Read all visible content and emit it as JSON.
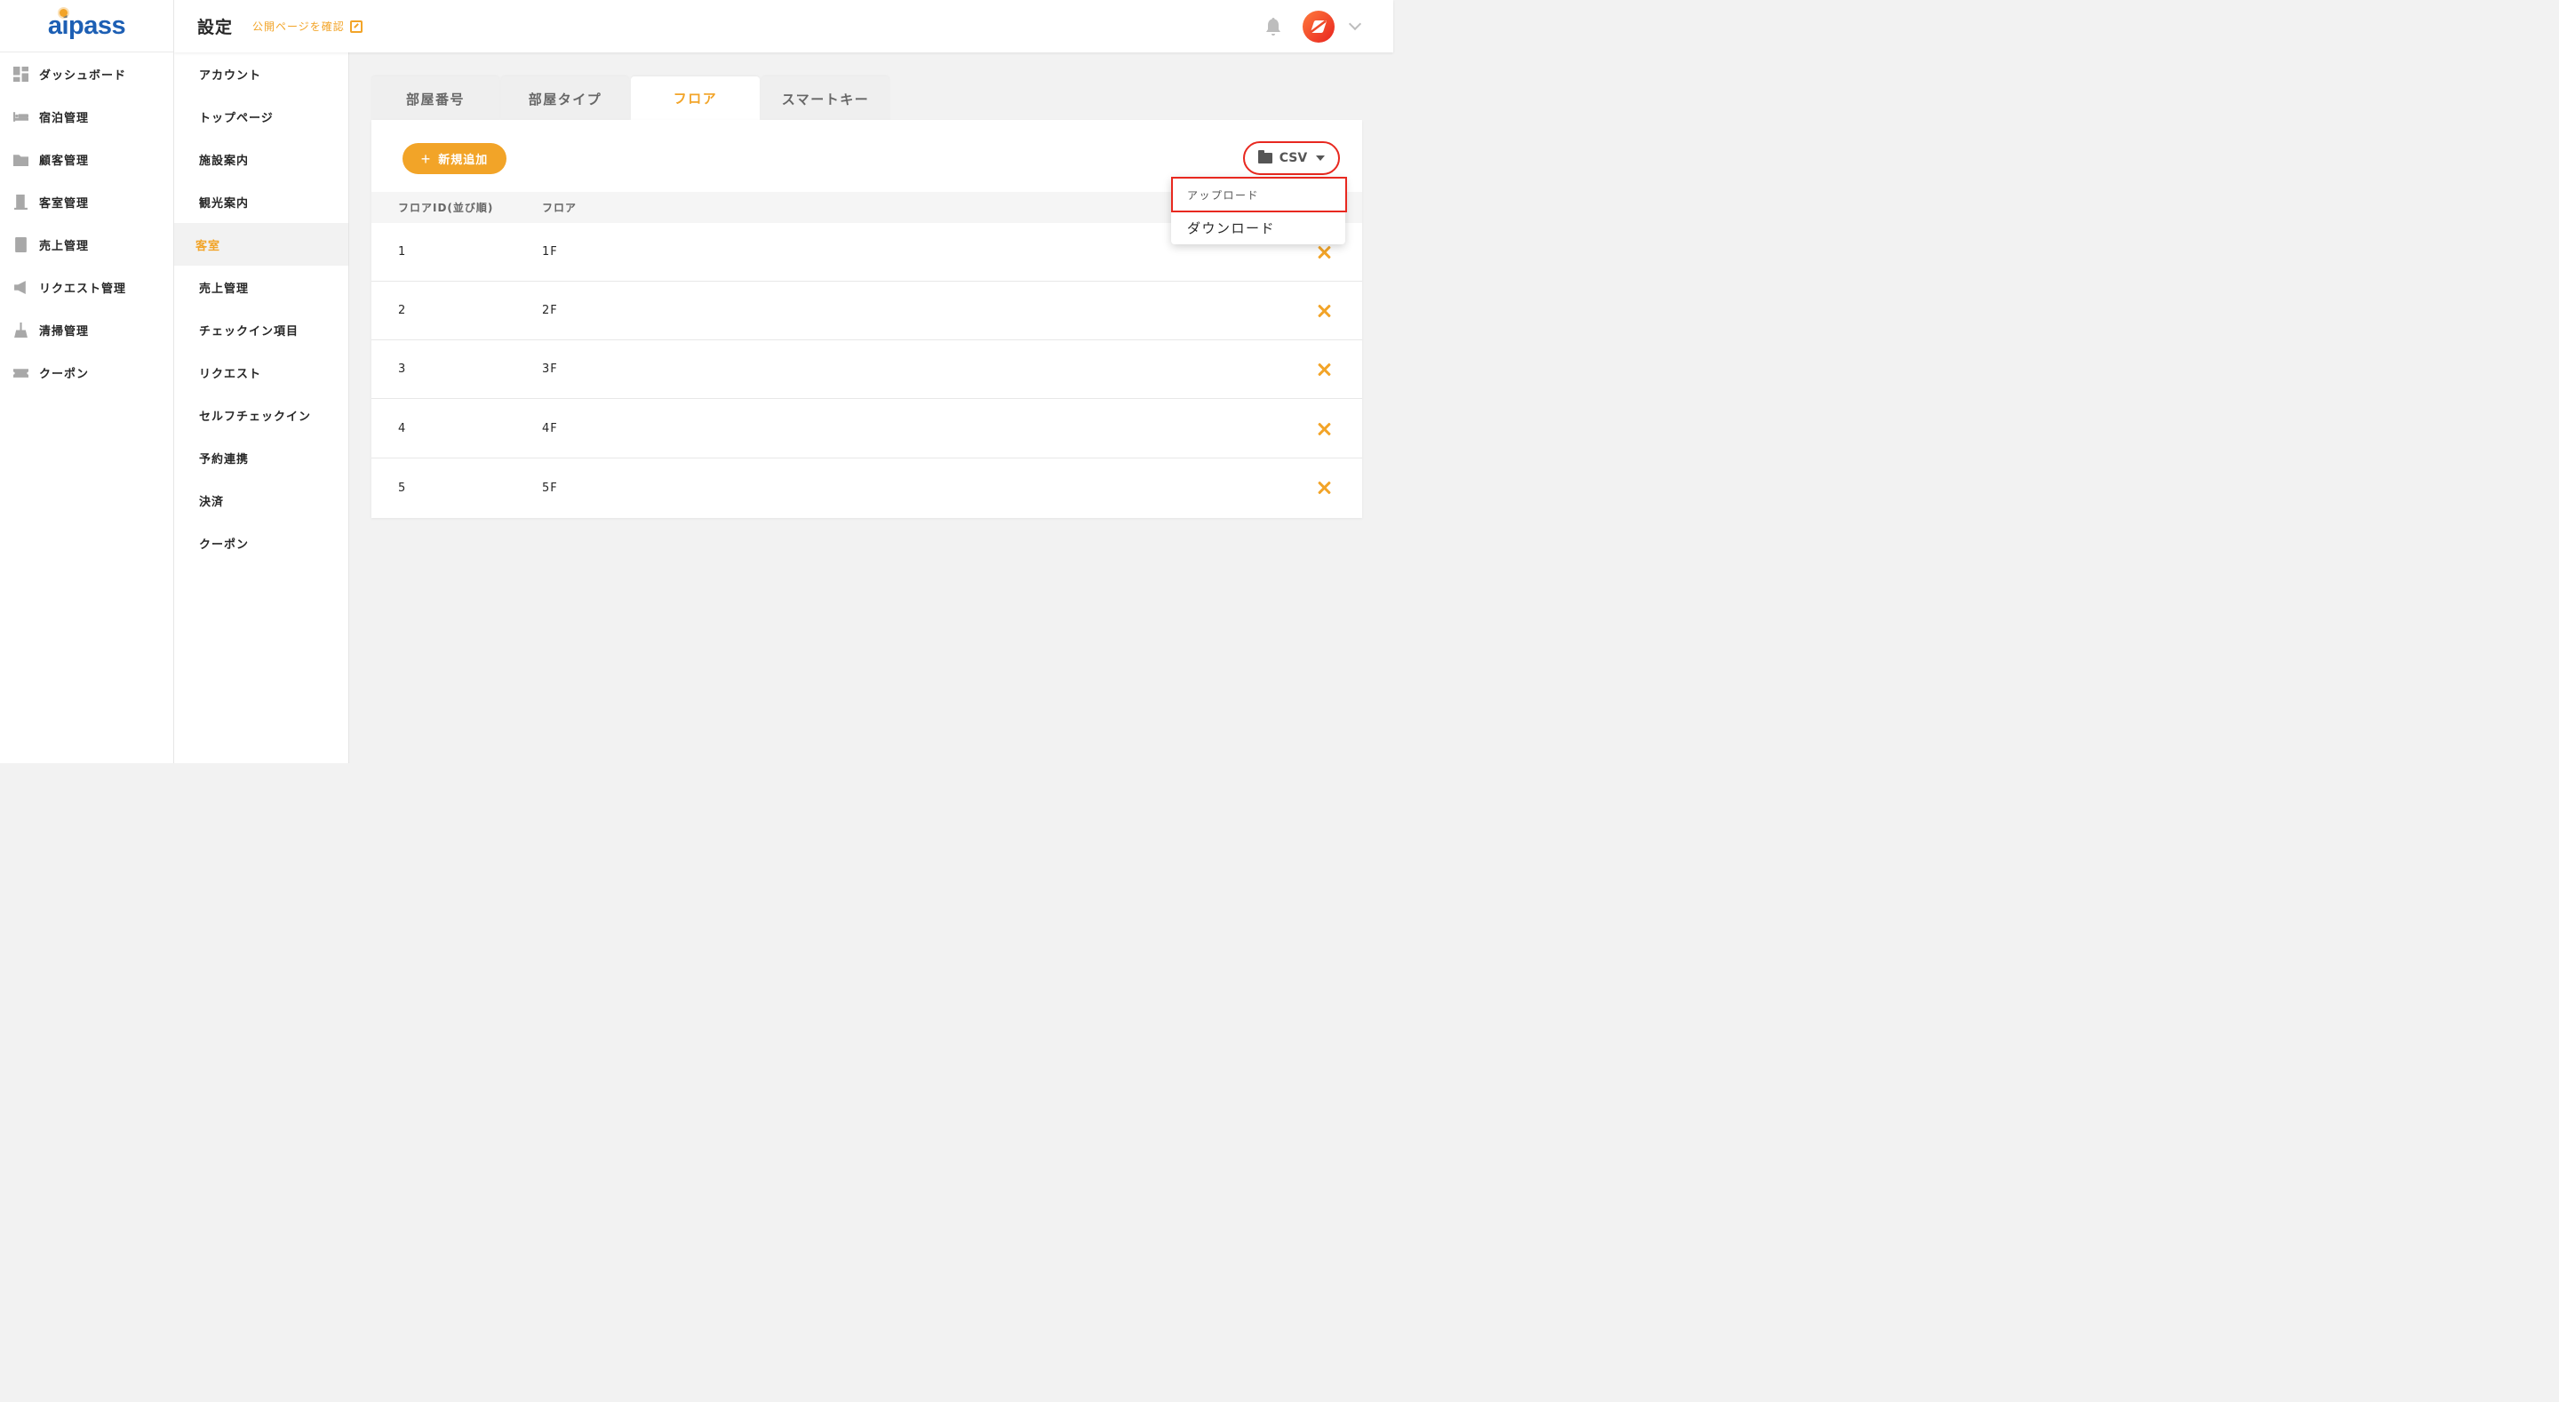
{
  "brand": {
    "logo_text": "aipass",
    "accent": "#f2a428",
    "logo_color": "#1d5fb4",
    "highlight": "#e8281f"
  },
  "header": {
    "title": "設定",
    "public_link": "公開ページを確認"
  },
  "leftnav": {
    "items": [
      {
        "label": "ダッシュボード",
        "icon": "dashboard-icon"
      },
      {
        "label": "宿泊管理",
        "icon": "bed-icon"
      },
      {
        "label": "顧客管理",
        "icon": "customer-folder-icon"
      },
      {
        "label": "客室管理",
        "icon": "door-icon"
      },
      {
        "label": "売上管理",
        "icon": "calculator-icon"
      },
      {
        "label": "リクエスト管理",
        "icon": "megaphone-icon"
      },
      {
        "label": "清掃管理",
        "icon": "broom-icon"
      },
      {
        "label": "クーポン",
        "icon": "ticket-icon"
      }
    ]
  },
  "subnav": {
    "items": [
      {
        "label": "アカウント"
      },
      {
        "label": "トップページ"
      },
      {
        "label": "施設案内"
      },
      {
        "label": "観光案内"
      },
      {
        "label": "客室",
        "active": true
      },
      {
        "label": "売上管理"
      },
      {
        "label": "チェックイン項目"
      },
      {
        "label": "リクエスト"
      },
      {
        "label": "セルフチェックイン"
      },
      {
        "label": "予約連携"
      },
      {
        "label": "決済"
      },
      {
        "label": "クーポン"
      }
    ]
  },
  "tabs": [
    {
      "label": "部屋番号"
    },
    {
      "label": "部屋タイプ"
    },
    {
      "label": "フロア",
      "active": true
    },
    {
      "label": "スマートキー"
    }
  ],
  "toolbar": {
    "add_label": "新規追加",
    "csv_label": "CSV"
  },
  "csv_menu": {
    "upload": "アップロード",
    "download": "ダウンロード"
  },
  "table": {
    "headers": [
      "フロアID(並び順)",
      "フロア"
    ],
    "rows": [
      [
        "1",
        "1F"
      ],
      [
        "2",
        "2F"
      ],
      [
        "3",
        "3F"
      ],
      [
        "4",
        "4F"
      ],
      [
        "5",
        "5F"
      ]
    ]
  }
}
